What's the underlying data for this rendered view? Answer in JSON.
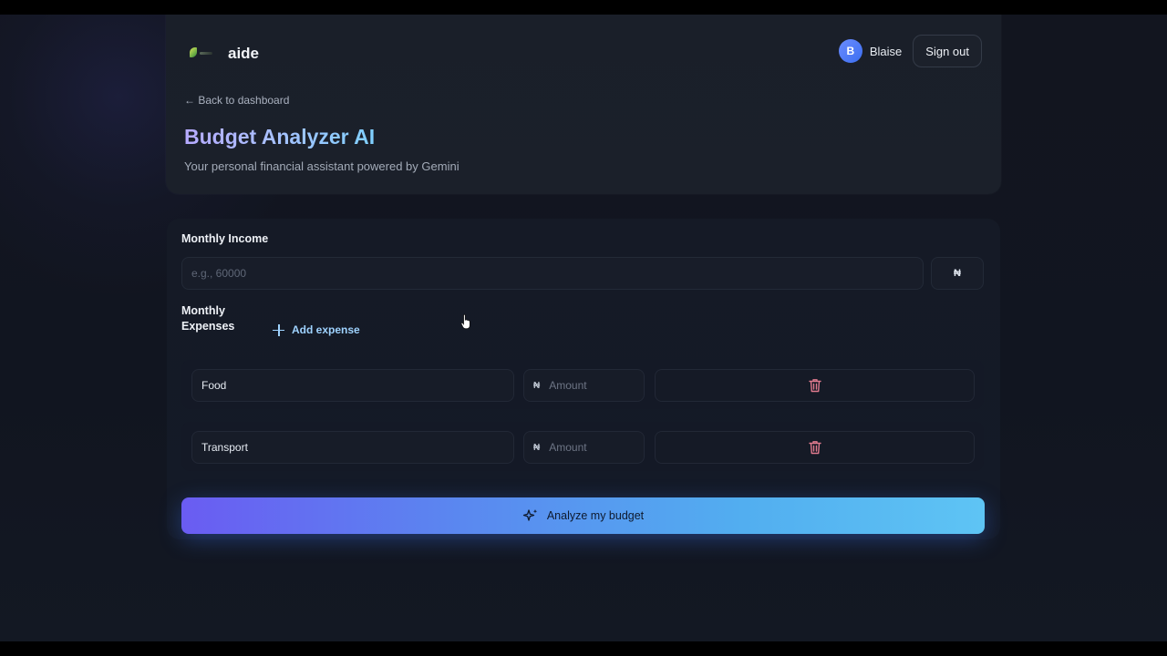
{
  "header": {
    "app_name": "aide",
    "user_initial": "B",
    "user_name": "Blaise",
    "signout_label": "Sign out",
    "back_link": "← Back to dashboard",
    "title": "Budget Analyzer AI",
    "subtitle": "Your personal financial assistant powered by Gemini"
  },
  "form": {
    "income_label": "Monthly Income",
    "income_placeholder": "e.g., 60000",
    "income_value": "",
    "currency_symbol": "₦",
    "expenses_label": "Monthly Expenses",
    "add_expense_label": "Add expense",
    "expenses": [
      {
        "name": "Food",
        "amount_placeholder": "Amount",
        "currency": "₦"
      },
      {
        "name": "Transport",
        "amount_placeholder": "Amount",
        "currency": "₦"
      }
    ],
    "analyze_label": "Analyze my budget"
  },
  "icons": {
    "logo": "aide-leaf-logo-icon",
    "add": "plus-icon",
    "delete": "trash-icon",
    "analyze": "sparkle-icon"
  },
  "colors": {
    "background": "#12151f",
    "card": "#1a1f29",
    "accent_gradient_start": "#6a5cf2",
    "accent_gradient_end": "#5ec4f4",
    "link": "#9fd3ff",
    "delete_icon": "#e07a8e",
    "avatar": "#3b6ef0"
  }
}
